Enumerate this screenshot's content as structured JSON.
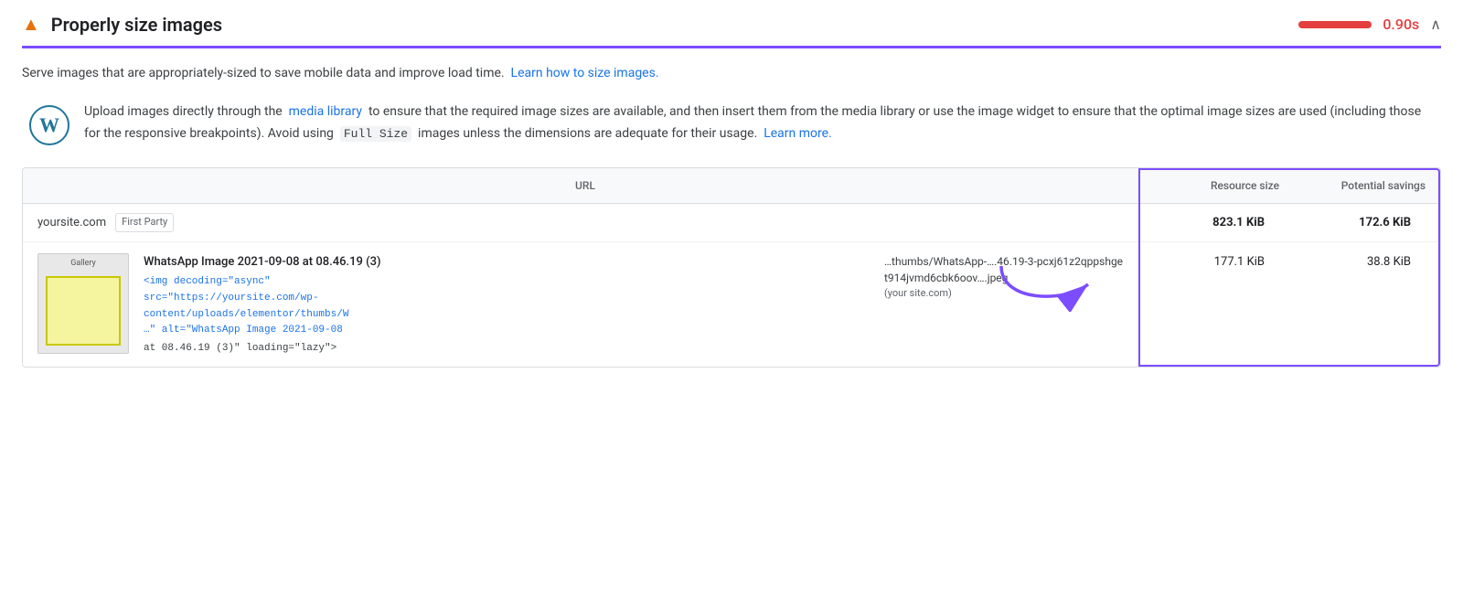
{
  "header": {
    "warning_icon": "▲",
    "title": "Properly size images",
    "score_bar_color": "#e53e3e",
    "score_time": "0.90s",
    "collapse_icon": "∧"
  },
  "description": {
    "text": "Serve images that are appropriately-sized to save mobile data and improve load time.",
    "link_text": "Learn how to size images.",
    "link_url": "#"
  },
  "tip": {
    "text_before": "Upload images directly through the",
    "media_library_link": "media library",
    "text_middle": "to ensure that the required image sizes are available, and then insert them from the media library or use the image widget to ensure that the optimal image sizes are used (including those for the responsive breakpoints). Avoid using",
    "code": "Full Size",
    "text_after": "images unless the dimensions are adequate for their usage.",
    "learn_more_link": "Learn more.",
    "learn_more_url": "#"
  },
  "table": {
    "headers": {
      "url": "URL",
      "resource_size": "Resource size",
      "potential_savings": "Potential savings"
    },
    "domain_row": {
      "domain": "yoursite.com",
      "badge": "First Party",
      "resource_size": "823.1 KiB",
      "potential_savings": "172.6 KiB"
    },
    "file_row": {
      "thumbnail_label": "Gallery",
      "title": "WhatsApp Image 2021-09-08 at 08.46.19 (3)",
      "code_line1": "<img decoding=\"async\"",
      "code_line2": "src=\"https://yoursite.com/wp-",
      "code_line3": "content/uploads/elementor/thumbs/W",
      "code_line4": "…\" alt=\"WhatsApp Image 2021-09-08",
      "alt_line": "at 08.46.19 (3)\" loading=\"lazy\">",
      "url_text": "…thumbs/WhatsApp-….46.19-3-pcxj61z2qppshget914jvmd6cbk6oov….jpeg",
      "url_domain": "(your site.com)",
      "resource_size": "177.1 KiB",
      "potential_savings": "38.8 KiB"
    }
  },
  "arrow": {
    "color": "#7c4dff"
  }
}
